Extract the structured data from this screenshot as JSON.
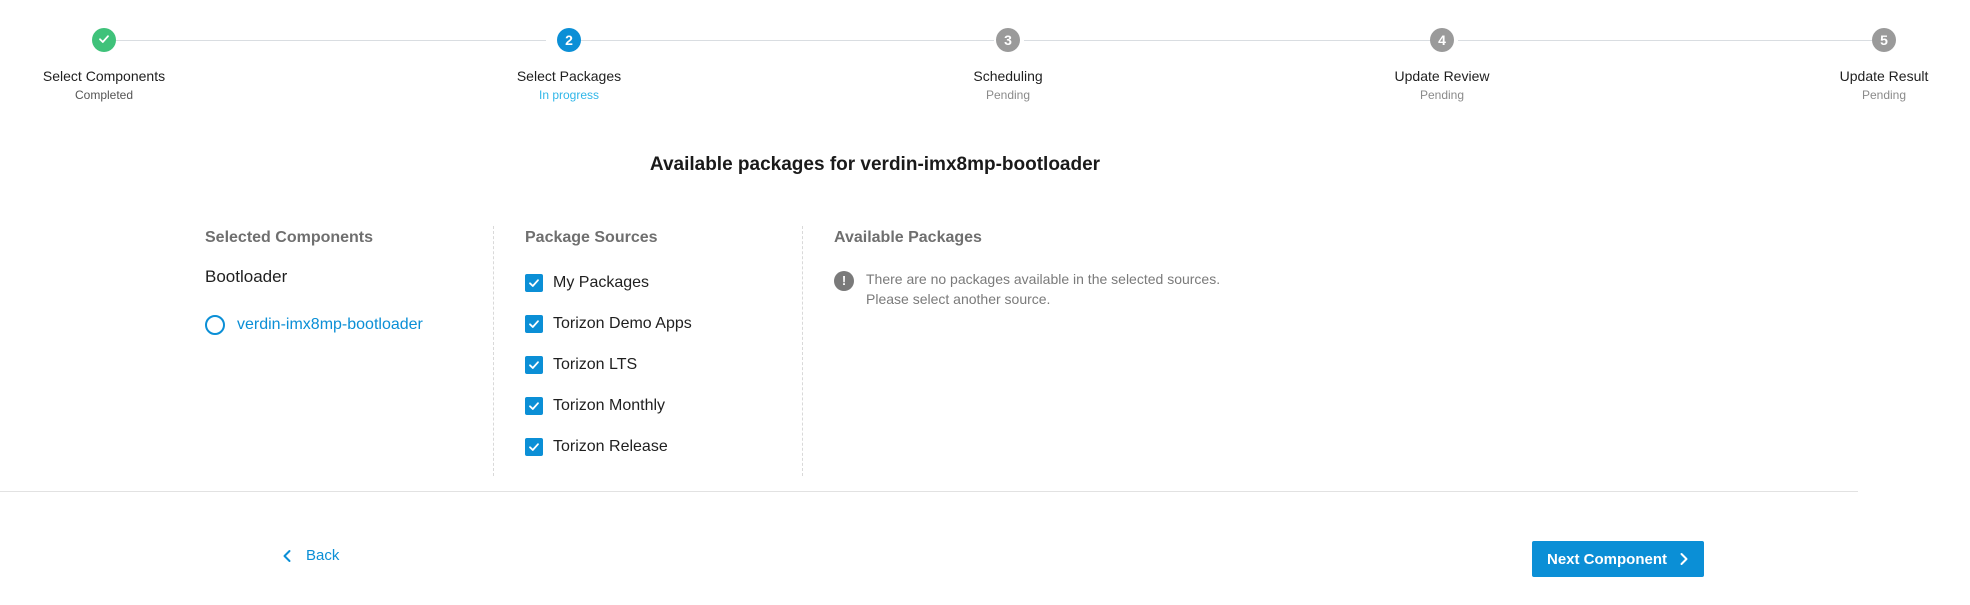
{
  "stepper": {
    "steps": [
      {
        "number": "",
        "title": "Select Components",
        "status": "Completed"
      },
      {
        "number": "2",
        "title": "Select Packages",
        "status": "In progress"
      },
      {
        "number": "3",
        "title": "Scheduling",
        "status": "Pending"
      },
      {
        "number": "4",
        "title": "Update Review",
        "status": "Pending"
      },
      {
        "number": "5",
        "title": "Update Result",
        "status": "Pending"
      }
    ]
  },
  "heading": "Available packages for verdin-imx8mp-bootloader",
  "selected_components": {
    "title": "Selected Components",
    "group": "Bootloader",
    "item": "verdin-imx8mp-bootloader"
  },
  "package_sources": {
    "title": "Package Sources",
    "items": [
      {
        "label": "My Packages",
        "checked": true
      },
      {
        "label": "Torizon Demo Apps",
        "checked": true
      },
      {
        "label": "Torizon LTS",
        "checked": true
      },
      {
        "label": "Torizon Monthly",
        "checked": true
      },
      {
        "label": "Torizon Release",
        "checked": true
      }
    ]
  },
  "available_packages": {
    "title": "Available Packages",
    "notice_line1": "There are no packages available in the selected sources.",
    "notice_line2": "Please select another source."
  },
  "footer": {
    "back_label": "Back",
    "next_label": "Next Component"
  },
  "colors": {
    "accent": "#0b8fd6",
    "success": "#3fc27a",
    "pending": "#9a9a9a",
    "in_progress_text": "#2fb6e8"
  },
  "icons": {
    "step1": "check-icon",
    "notice": "exclamation-icon",
    "back": "chevron-left-icon",
    "next": "chevron-right-icon",
    "checkbox": "checkmark-icon",
    "radio": "radio-empty-icon"
  }
}
